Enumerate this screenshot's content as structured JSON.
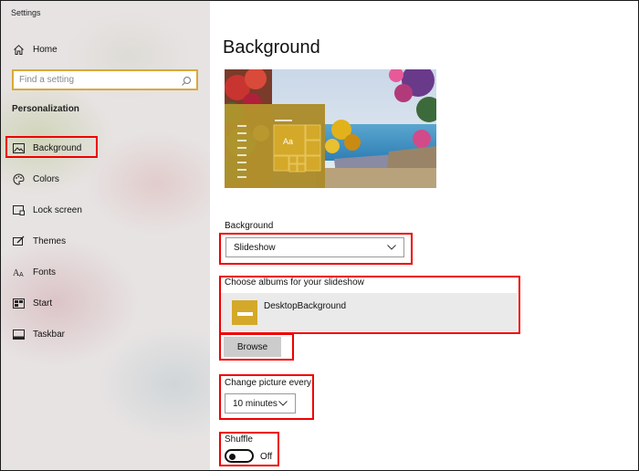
{
  "window": {
    "title": "Settings"
  },
  "sidebar": {
    "home": {
      "label": "Home",
      "icon": "home-icon"
    },
    "search": {
      "placeholder": "Find a setting",
      "value": ""
    },
    "section": "Personalization",
    "items": [
      {
        "label": "Background",
        "icon": "picture-icon",
        "selected": true
      },
      {
        "label": "Colors",
        "icon": "palette-icon"
      },
      {
        "label": "Lock screen",
        "icon": "lock-screen-icon"
      },
      {
        "label": "Themes",
        "icon": "brush-icon"
      },
      {
        "label": "Fonts",
        "icon": "font-icon"
      },
      {
        "label": "Start",
        "icon": "start-icon"
      },
      {
        "label": "Taskbar",
        "icon": "taskbar-icon"
      }
    ]
  },
  "main": {
    "title": "Background",
    "preview": {
      "sample_text": "Aa"
    },
    "background": {
      "label": "Background",
      "value": "Slideshow"
    },
    "albums": {
      "label": "Choose albums for your slideshow",
      "album_name": "DesktopBackground",
      "browse_label": "Browse"
    },
    "interval": {
      "label": "Change picture every",
      "value": "10 minutes"
    },
    "shuffle": {
      "label": "Shuffle",
      "state": "Off"
    }
  },
  "colors": {
    "accent": "#d4a929",
    "highlight_box": "#e00000",
    "search_border": "#d9a93a"
  }
}
